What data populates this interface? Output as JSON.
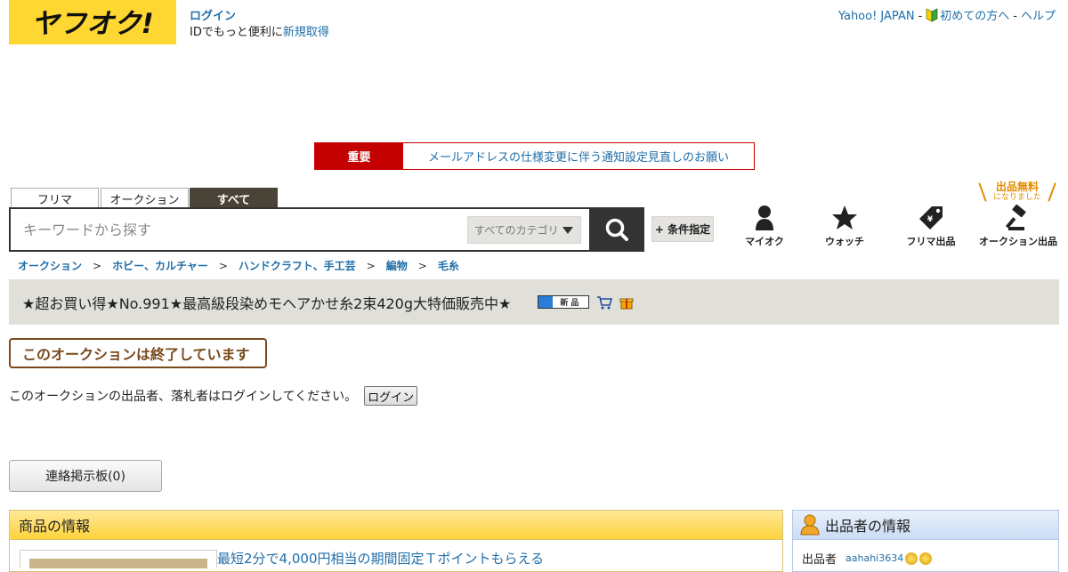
{
  "header": {
    "logo_text": "ヤフオク!",
    "login_link": "ログイン",
    "login_sub_prefix": "IDでもっと便利に",
    "register_link": "新規取得",
    "toplinks": {
      "yahoo_japan": "Yahoo! JAPAN",
      "sep": "-",
      "beginners": "初めての方へ",
      "help": "ヘルプ"
    }
  },
  "notice": {
    "badge": "重要",
    "text": "メールアドレスの仕様変更に伴う通知設定見直しのお願い"
  },
  "search": {
    "tabs": [
      {
        "label": "フリマ",
        "active": false
      },
      {
        "label": "オークション",
        "active": false
      },
      {
        "label": "すべて",
        "active": true
      }
    ],
    "placeholder": "キーワードから探す",
    "category": "すべてのカテゴリ",
    "condition_button": "+ 条件指定"
  },
  "nav": {
    "promo_title": "出品無料",
    "promo_sub": "になりました",
    "items": [
      {
        "label": "マイオク",
        "icon": "person-icon"
      },
      {
        "label": "ウォッチ",
        "icon": "star-icon"
      },
      {
        "label": "フリマ出品",
        "icon": "price-tag-icon"
      },
      {
        "label": "オークション出品",
        "icon": "gavel-icon"
      }
    ]
  },
  "breadcrumb": {
    "items": [
      "オークション",
      "ホビー、カルチャー",
      "ハンドクラフト、手工芸",
      "編物",
      "毛糸"
    ],
    "separator": ">"
  },
  "item": {
    "title": "★超お買い得★No.991★最高級段染めモヘアかせ糸2束420g大特価販売中★",
    "new_badge": "新品",
    "ended_message": "このオークションは終了しています",
    "login_notice": "このオークションの出品者、落札者はログインしてください。",
    "login_button": "ログイン",
    "board_button": "連絡掲示板(0)"
  },
  "item_panel": {
    "title": "商品の情報",
    "promo_link": "最短2分で4,000円相当の期間固定Ｔポイントもらえる"
  },
  "seller_panel": {
    "title": "出品者の情報",
    "label": "出品者",
    "seller_id": "aahahi3634"
  },
  "colors": {
    "logo_yellow": "#fed733",
    "accent_red": "#c40000",
    "link_blue": "#1f6ea8",
    "ended_brown": "#7a4a1c",
    "promo_orange": "#e38b00"
  }
}
